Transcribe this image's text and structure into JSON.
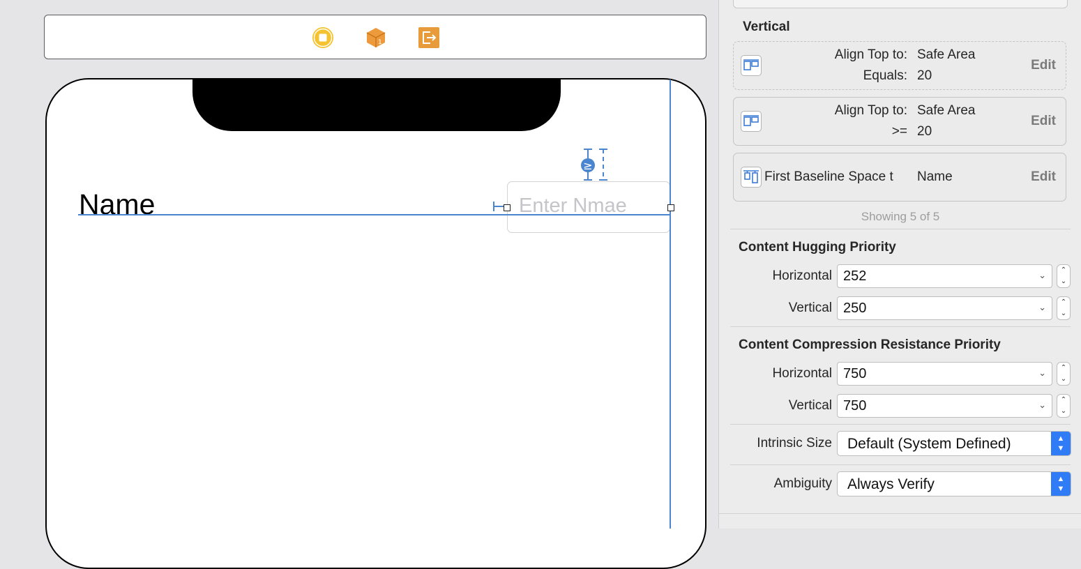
{
  "canvas": {
    "label_text": "Name",
    "textfield_placeholder": "Enter Nmae",
    "dock_icons": [
      "view-controller-icon",
      "first-responder-icon",
      "exit-icon"
    ],
    "dock_colors": {
      "view_controller": "#f5c330",
      "first_responder": "#ec9a3b",
      "exit": "#e89b3a"
    },
    "constraint_color": "#4a86d0",
    "relation_badge": "≥"
  },
  "inspector": {
    "vertical_title": "Vertical",
    "constraints": [
      {
        "label_line1": "Align Top to:",
        "value_line1": "Safe Area",
        "label_line2": "Equals:",
        "value_line2": "20",
        "edit": "Edit",
        "dashed": true
      },
      {
        "label_line1": "Align Top to:",
        "value_line1": "Safe Area",
        "label_line2": ">=",
        "value_line2": "20",
        "edit": "Edit",
        "dashed": false
      },
      {
        "label_line1": "First Baseline Space t",
        "value_line1": "Name",
        "edit": "Edit",
        "dashed": false
      }
    ],
    "showing": "Showing 5 of 5",
    "hugging": {
      "title": "Content Hugging Priority",
      "horizontal_label": "Horizontal",
      "horizontal_value": "252",
      "vertical_label": "Vertical",
      "vertical_value": "250"
    },
    "compression": {
      "title": "Content Compression Resistance Priority",
      "horizontal_label": "Horizontal",
      "horizontal_value": "750",
      "vertical_label": "Vertical",
      "vertical_value": "750"
    },
    "intrinsic_size": {
      "label": "Intrinsic Size",
      "value": "Default (System Defined)"
    },
    "ambiguity": {
      "label": "Ambiguity",
      "value": "Always Verify"
    },
    "accent": "#2f7cf6"
  }
}
